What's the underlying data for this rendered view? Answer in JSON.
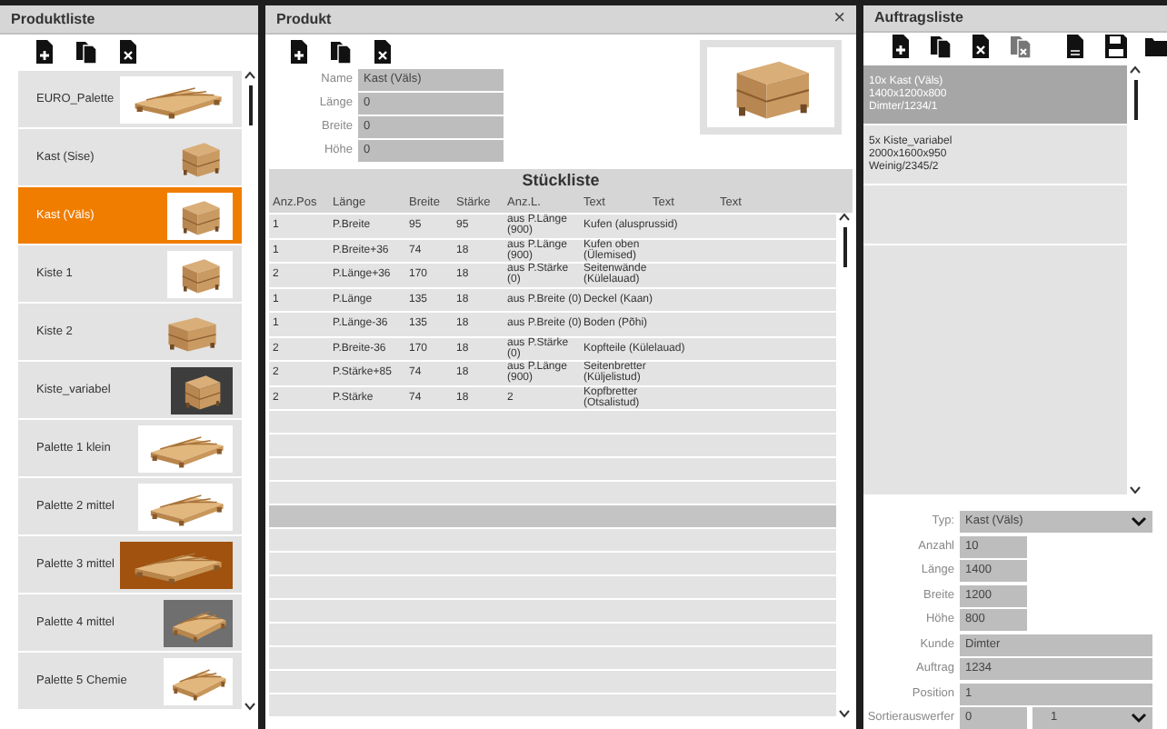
{
  "produktliste": {
    "title": "Produktliste",
    "items": [
      {
        "name": "EURO_Palette",
        "selected": false
      },
      {
        "name": "Kast (Sise)",
        "selected": false
      },
      {
        "name": "Kast (Väls)",
        "selected": true
      },
      {
        "name": "Kiste 1",
        "selected": false
      },
      {
        "name": "Kiste 2",
        "selected": false
      },
      {
        "name": "Kiste_variabel",
        "selected": false
      },
      {
        "name": "Palette 1 klein",
        "selected": false
      },
      {
        "name": "Palette 2 mittel",
        "selected": false
      },
      {
        "name": "Palette 3 mittel",
        "selected": false
      },
      {
        "name": "Palette 4 mittel",
        "selected": false
      },
      {
        "name": "Palette 5 Chemie",
        "selected": false
      }
    ]
  },
  "produkt": {
    "title": "Produkt",
    "close": "×",
    "fields": [
      {
        "label": "Name",
        "value": "Kast (Väls)"
      },
      {
        "label": "Länge",
        "value": "0"
      },
      {
        "label": "Breite",
        "value": "0"
      },
      {
        "label": "Höhe",
        "value": "0"
      }
    ],
    "stueckliste": {
      "title": "Stückliste",
      "columns": [
        "Anz.Pos",
        "Länge",
        "Breite",
        "Stärke",
        "Anz.L.",
        "Text",
        "Text",
        "Text"
      ],
      "rows": [
        {
          "cells": [
            "1",
            "P.Breite",
            "95",
            "95",
            "aus P.Länge (900)",
            "Kufen (alusprussid)"
          ],
          "selected": false
        },
        {
          "cells": [
            "1",
            "P.Breite+36",
            "74",
            "18",
            "aus P.Länge (900)",
            "Kufen oben (Ülemised)"
          ],
          "selected": false
        },
        {
          "cells": [
            "2",
            "P.Länge+36",
            "170",
            "18",
            "aus P.Stärke (0)",
            "Seitenwände (Külelauad)"
          ],
          "selected": false
        },
        {
          "cells": [
            "1",
            "P.Länge",
            "135",
            "18",
            "aus P.Breite (0)",
            "Deckel (Kaan)"
          ],
          "selected": false
        },
        {
          "cells": [
            "1",
            "P.Länge-36",
            "135",
            "18",
            "aus P.Breite (0)",
            "Boden (Põhi)"
          ],
          "selected": false
        },
        {
          "cells": [
            "2",
            "P.Breite-36",
            "170",
            "18",
            "aus P.Stärke (0)",
            "Kopfteile (Külelauad)"
          ],
          "selected": false
        },
        {
          "cells": [
            "2",
            "P.Stärke+85",
            "74",
            "18",
            "aus P.Länge (900)",
            "Seitenbretter (Küljelistud)"
          ],
          "selected": false
        },
        {
          "cells": [
            "2",
            "P.Stärke",
            "74",
            "18",
            "2",
            "Kopfbretter (Otsalistud)"
          ],
          "selected": false
        }
      ],
      "empty_rows": [
        {
          "selected": false
        },
        {
          "selected": false
        },
        {
          "selected": false
        },
        {
          "selected": false
        },
        {
          "selected": true
        },
        {
          "selected": false
        },
        {
          "selected": false
        },
        {
          "selected": false
        },
        {
          "selected": false
        },
        {
          "selected": false
        },
        {
          "selected": false
        },
        {
          "selected": false
        },
        {
          "selected": false
        }
      ]
    }
  },
  "auftragsliste": {
    "title": "Auftragsliste",
    "items": [
      {
        "lines": [
          "10x Kast (Väls)",
          "1400x1200x800",
          "Dimter/1234/1"
        ],
        "selected": true
      },
      {
        "lines": [
          "5x Kiste_variabel",
          "2000x1600x950",
          "Weinig/2345/2"
        ],
        "selected": false
      }
    ],
    "fields": [
      {
        "kind": "dropdown",
        "label": "Typ:",
        "value": "Kast (Väls)"
      },
      {
        "kind": "short",
        "label": "Anzahl",
        "value": "10"
      },
      {
        "kind": "short",
        "label": "Länge",
        "value": "1400"
      },
      {
        "kind": "short",
        "label": "Breite",
        "value": "1200"
      },
      {
        "kind": "short",
        "label": "Höhe",
        "value": "800"
      },
      {
        "kind": "long",
        "label": "Kunde",
        "value": "Dimter"
      },
      {
        "kind": "long",
        "label": "Auftrag",
        "value": "1234"
      },
      {
        "kind": "long",
        "label": "Position",
        "value": "1"
      },
      {
        "kind": "pair",
        "label": "Sortierauswerfer",
        "value": "0",
        "value2": "1"
      }
    ]
  }
}
